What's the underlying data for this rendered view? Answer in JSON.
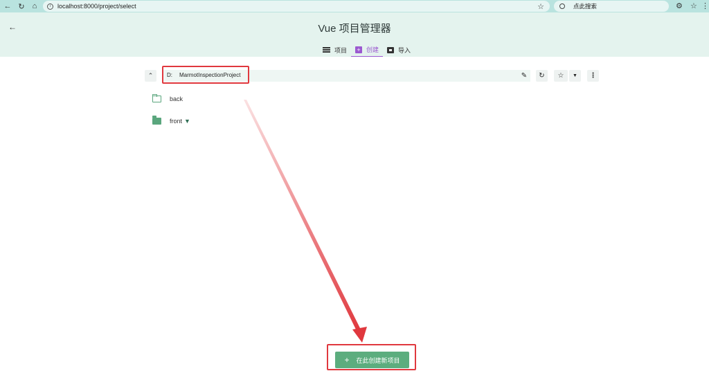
{
  "browser": {
    "url": "localhost:8000/project/select",
    "search_placeholder": "点此搜索"
  },
  "header": {
    "title": "Vue 项目管理器",
    "tabs": [
      {
        "label": "项目",
        "icon": "list-icon",
        "active": false
      },
      {
        "label": "创建",
        "icon": "add-box-icon",
        "active": true
      },
      {
        "label": "导入",
        "icon": "import-icon",
        "active": false
      }
    ]
  },
  "path": {
    "drive": "D:",
    "folder": "MarmotInspectionProject"
  },
  "folders": [
    {
      "name": "back",
      "icon": "folder-outline-icon"
    },
    {
      "name": "front",
      "icon": "folder-filled-icon"
    }
  ],
  "actions": {
    "create_label": "在此创建新项目"
  },
  "colors": {
    "accent": "#9b59d0",
    "primary_green": "#5cad7e",
    "header_bg": "#e4f3ee",
    "annotation_red": "#e0383e"
  }
}
